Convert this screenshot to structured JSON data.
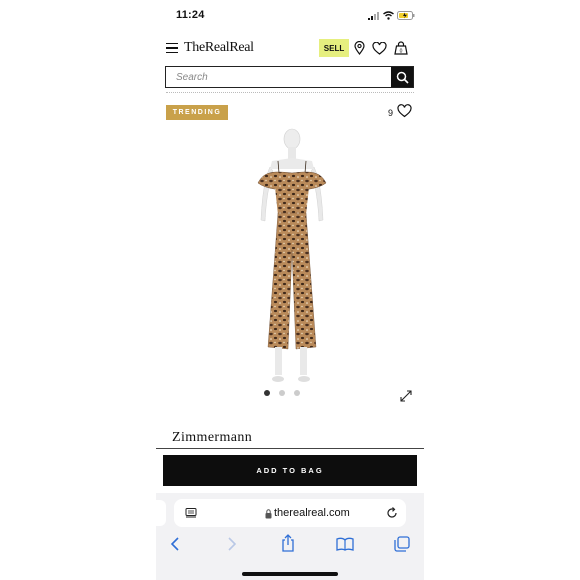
{
  "status_bar": {
    "time": "11:24"
  },
  "header": {
    "logo": "TheRealReal",
    "sell_label": "SELL"
  },
  "search": {
    "placeholder": "Search"
  },
  "product": {
    "badge": "TRENDING",
    "like_count": "9",
    "brand": "Zimmermann",
    "image_count": 3,
    "active_image": 1
  },
  "cta": {
    "add_to_bag": "ADD TO BAG"
  },
  "browser": {
    "url": "therealreal.com"
  },
  "colors": {
    "sell_bg": "#e6ef7f",
    "badge_bg": "#c9a14a",
    "button_bg": "#0d0d0d"
  },
  "icons": [
    "menu-icon",
    "location-pin-icon",
    "heart-icon",
    "shopping-bag-icon",
    "search-icon",
    "expand-icon",
    "reader-icon",
    "lock-icon",
    "reload-icon",
    "back-icon",
    "forward-icon",
    "share-icon",
    "bookmarks-icon",
    "tabs-icon"
  ]
}
